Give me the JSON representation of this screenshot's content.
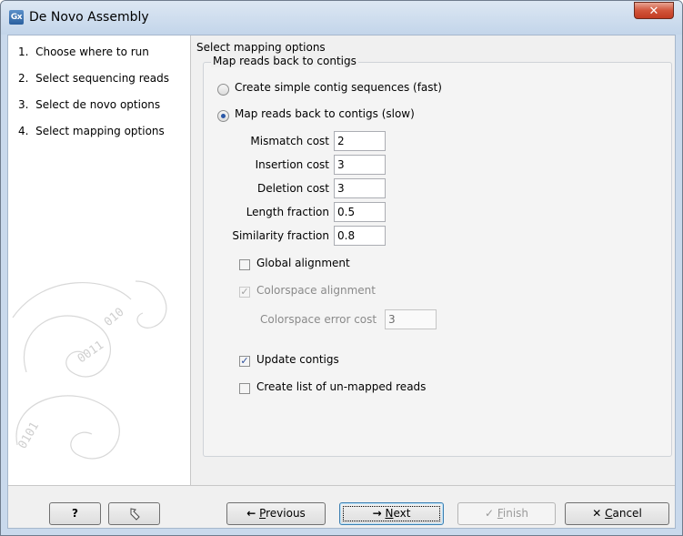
{
  "window": {
    "title": "De Novo Assembly",
    "app_icon_text": "Gx",
    "close_glyph": "✕"
  },
  "steps": [
    {
      "number": "1.",
      "label": "Choose where to run"
    },
    {
      "number": "2.",
      "label": "Select sequencing reads"
    },
    {
      "number": "3.",
      "label": "Select de novo options"
    },
    {
      "number": "4.",
      "label": "Select mapping options"
    }
  ],
  "main": {
    "title": "Select mapping options",
    "group_title": "Map reads back to contigs",
    "radio_options": [
      {
        "label": "Create simple contig sequences (fast)",
        "selected": false
      },
      {
        "label": "Map reads back to contigs (slow)",
        "selected": true
      }
    ],
    "fields": [
      {
        "label": "Mismatch cost",
        "value": "2"
      },
      {
        "label": "Insertion cost",
        "value": "3"
      },
      {
        "label": "Deletion cost",
        "value": "3"
      },
      {
        "label": "Length fraction",
        "value": "0.5"
      },
      {
        "label": "Similarity fraction",
        "value": "0.8"
      }
    ],
    "global_alignment": {
      "label": "Global alignment",
      "checked": false
    },
    "colorspace_alignment": {
      "label": "Colorspace alignment",
      "checked": true,
      "enabled": false
    },
    "colorspace_error_cost": {
      "label": "Colorspace error cost",
      "value": "3",
      "enabled": false
    },
    "update_contigs": {
      "label": "Update contigs",
      "checked": true
    },
    "unmapped_reads": {
      "label": "Create list of un-mapped reads",
      "checked": false
    }
  },
  "buttons": {
    "help": "?",
    "reset_icon": "reset-icon",
    "previous_arrow": "←",
    "previous_key": "P",
    "previous_rest": "revious",
    "next_arrow": "→",
    "next_key": "N",
    "next_rest": "ext",
    "finish_check": "✓",
    "finish_key": "F",
    "finish_rest": "inish",
    "cancel_x": "✕",
    "cancel_key": "C",
    "cancel_rest": "ancel"
  }
}
